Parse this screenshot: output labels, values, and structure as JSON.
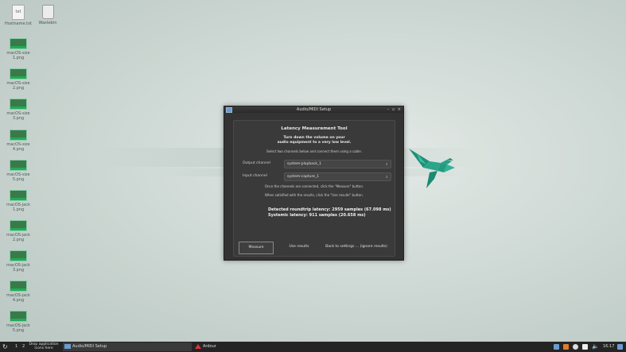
{
  "desktop": {
    "icons": [
      {
        "type": "txt",
        "label": "Hostname.txt",
        "glyph": "txt"
      },
      {
        "type": "trash",
        "label": "Wastebin"
      },
      {
        "type": "png",
        "label": "macOS-size 1.png"
      },
      {
        "type": "png",
        "label": "macOS-size 2.png"
      },
      {
        "type": "png",
        "label": "macOS-size 3.png"
      },
      {
        "type": "png",
        "label": "macOS-size 4.png"
      },
      {
        "type": "png",
        "label": "macOS-size 5.png"
      },
      {
        "type": "png",
        "label": "macOS-jack 1.png"
      },
      {
        "type": "png",
        "label": "macOS-jack 2.png"
      },
      {
        "type": "png",
        "label": "macOS-jack 3.png"
      },
      {
        "type": "png",
        "label": "macOS-jack 4.png"
      },
      {
        "type": "png",
        "label": "macOS-jack 5.png"
      }
    ]
  },
  "dialog": {
    "title": "Audio/MIDI Setup",
    "controls": "– ▫ ×",
    "heading": "Latency Measurement Tool",
    "warning_line1": "Turn down the volume on your",
    "warning_line2": "audio equipment to a very low level.",
    "instruction": "Select two channels below and connect them using a cable.",
    "output_label": "Output channel",
    "output_value": "system:playback_1",
    "input_label": "Input channel",
    "input_value": "system:capture_1",
    "hint_measure": "Once the channels are connected, click the \"Measure\" button.",
    "hint_results": "When satisfied with the results, click the \"Use results\" button.",
    "result_roundtrip": "Detected roundtrip latency: 2959 samples (67.098 ms)",
    "result_systemic": "Systemic latency: 911 samples (20.658 ms)",
    "buttons": {
      "measure": "Measure",
      "use_results": "Use results",
      "back": "Back to settings ... (ignore results)"
    }
  },
  "taskbar": {
    "workspace_1": "1",
    "workspace_2": "2",
    "launcher_hint_1": "Drop application",
    "launcher_hint_2": "icons here",
    "task_1": "Audio/MIDI Setup",
    "task_2": "Ardour",
    "clock": "16:17"
  },
  "colors": {
    "accent_bird": "#2aa58a",
    "dialog_bg": "#333333",
    "taskbar_bg": "#242424"
  }
}
